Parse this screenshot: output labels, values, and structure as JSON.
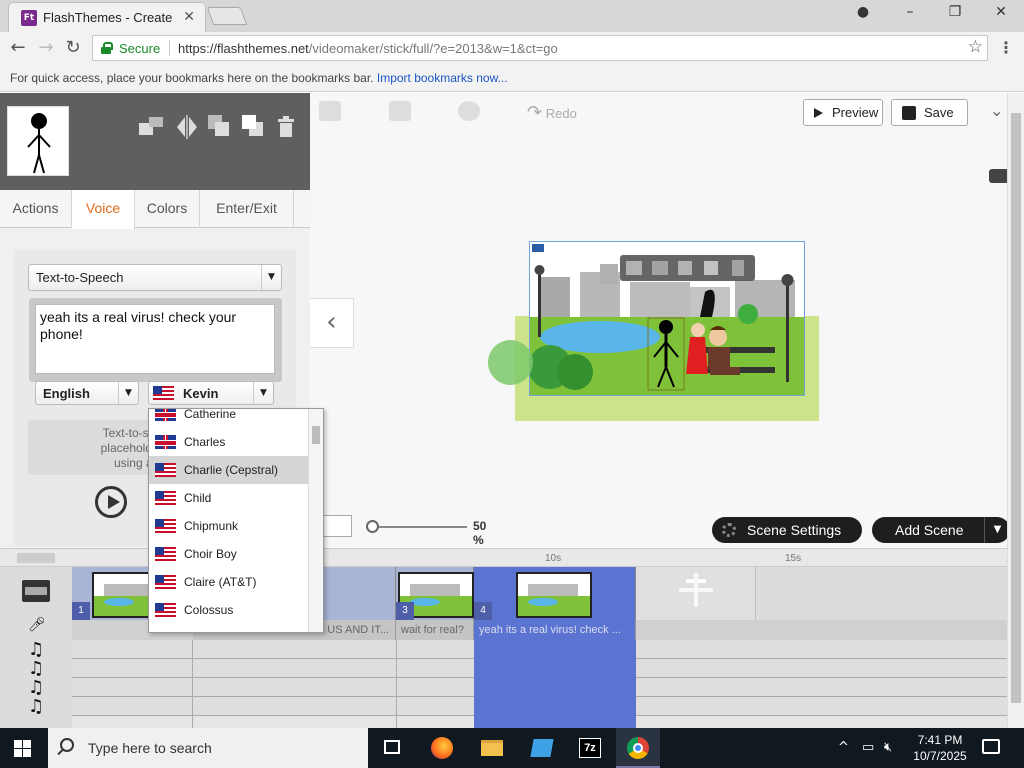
{
  "browser": {
    "tab_title": "FlashThemes - Create",
    "favicon_text": "Ft",
    "secure_label": "Secure",
    "url_base": "https://flashthemes.net",
    "url_path": "/videomaker/stick/full/?e=2013&w=1&ct=go",
    "bookmarks_text": "For quick access, place your bookmarks here on the bookmarks bar.",
    "bookmarks_link": "Import bookmarks now..."
  },
  "toolbar": {
    "redo_label": "Redo",
    "preview_label": "Preview",
    "save_label": "Save"
  },
  "panel": {
    "tabs": [
      {
        "label": "Actions"
      },
      {
        "label": "Voice"
      },
      {
        "label": "Colors"
      },
      {
        "label": "Enter/Exit"
      }
    ],
    "active_tab": "Voice",
    "mode_select": "Text-to-Speech",
    "tts_text": "yeah its a real virus! check your phone!",
    "language_select": "English",
    "voice_select": "Kevin",
    "note_lines": [
      "Text-to-speech qual",
      "placeholder. For you",
      "using a better v"
    ]
  },
  "voice_list": [
    {
      "label": "Catherine",
      "flag": "uk"
    },
    {
      "label": "Charles",
      "flag": "uk"
    },
    {
      "label": "Charlie (Cepstral)",
      "flag": "us",
      "selected": true
    },
    {
      "label": "Child",
      "flag": "us"
    },
    {
      "label": "Chipmunk",
      "flag": "us"
    },
    {
      "label": "Choir Boy",
      "flag": "us"
    },
    {
      "label": "Claire (AT&T)",
      "flag": "us"
    },
    {
      "label": "Colossus",
      "flag": "us"
    }
  ],
  "stage": {
    "zoom_label": "50 %",
    "scene_settings_label": "Scene Settings",
    "add_scene_label": "Add Scene"
  },
  "timeline": {
    "ruler_ticks": [
      "10s",
      "15s"
    ],
    "scene_numbers": [
      "1",
      "3",
      "4"
    ],
    "voice_segments": [
      "US AND IT...",
      "wait for real?",
      "yeah its a real virus! check ..."
    ]
  },
  "taskbar": {
    "search_placeholder": "Type here to search",
    "time": "7:41 PM",
    "date": "10/7/2025"
  },
  "colors": {
    "accent_orange": "#e06b1a",
    "timeline_selected": "#5b74d1",
    "secure_green": "#1a8a2a"
  }
}
